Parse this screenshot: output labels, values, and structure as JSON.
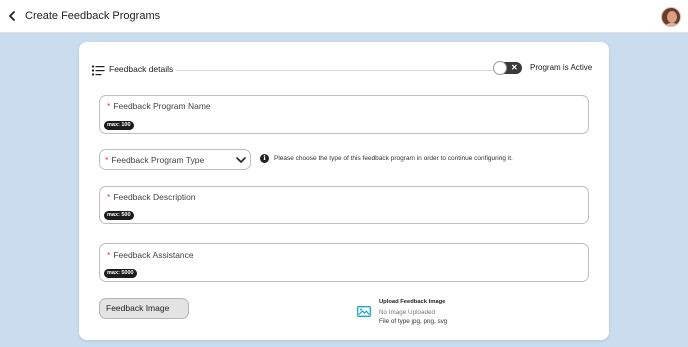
{
  "header": {
    "title": "Create Feedback Programs"
  },
  "icons": {
    "back": "chevron-left-icon",
    "avatar": "user-avatar",
    "section": "list-icon",
    "dropdown": "chevron-down-icon",
    "info": "info-icon",
    "upload": "image-icon"
  },
  "section": {
    "title": "Feedback details"
  },
  "toggle": {
    "knob_glyph": "✕",
    "label": "Program is Active",
    "checked": false
  },
  "fields": {
    "name": {
      "required_mark": "*",
      "label": "Feedback Program Name",
      "max": "max: 100"
    },
    "type": {
      "required_mark": "*",
      "label": "Feedback Program Type",
      "info": "Please choose the type of this feedback program in order to continue configuring it."
    },
    "description": {
      "required_mark": "*",
      "label": "Feedback Description",
      "max": "max: 500"
    },
    "assistance": {
      "required_mark": "*",
      "label": "Feedback Assistance",
      "max": "max: 5000"
    }
  },
  "image": {
    "button_label": "Feedback Image",
    "upload_title": "Upload Feedback Image",
    "status": "No Image Uploaded",
    "file_types": "File of type jpg, png, svg"
  },
  "colors": {
    "background": "#c9ddef",
    "required": "#e23b3b",
    "upload_icon": "#1aa5c9"
  }
}
